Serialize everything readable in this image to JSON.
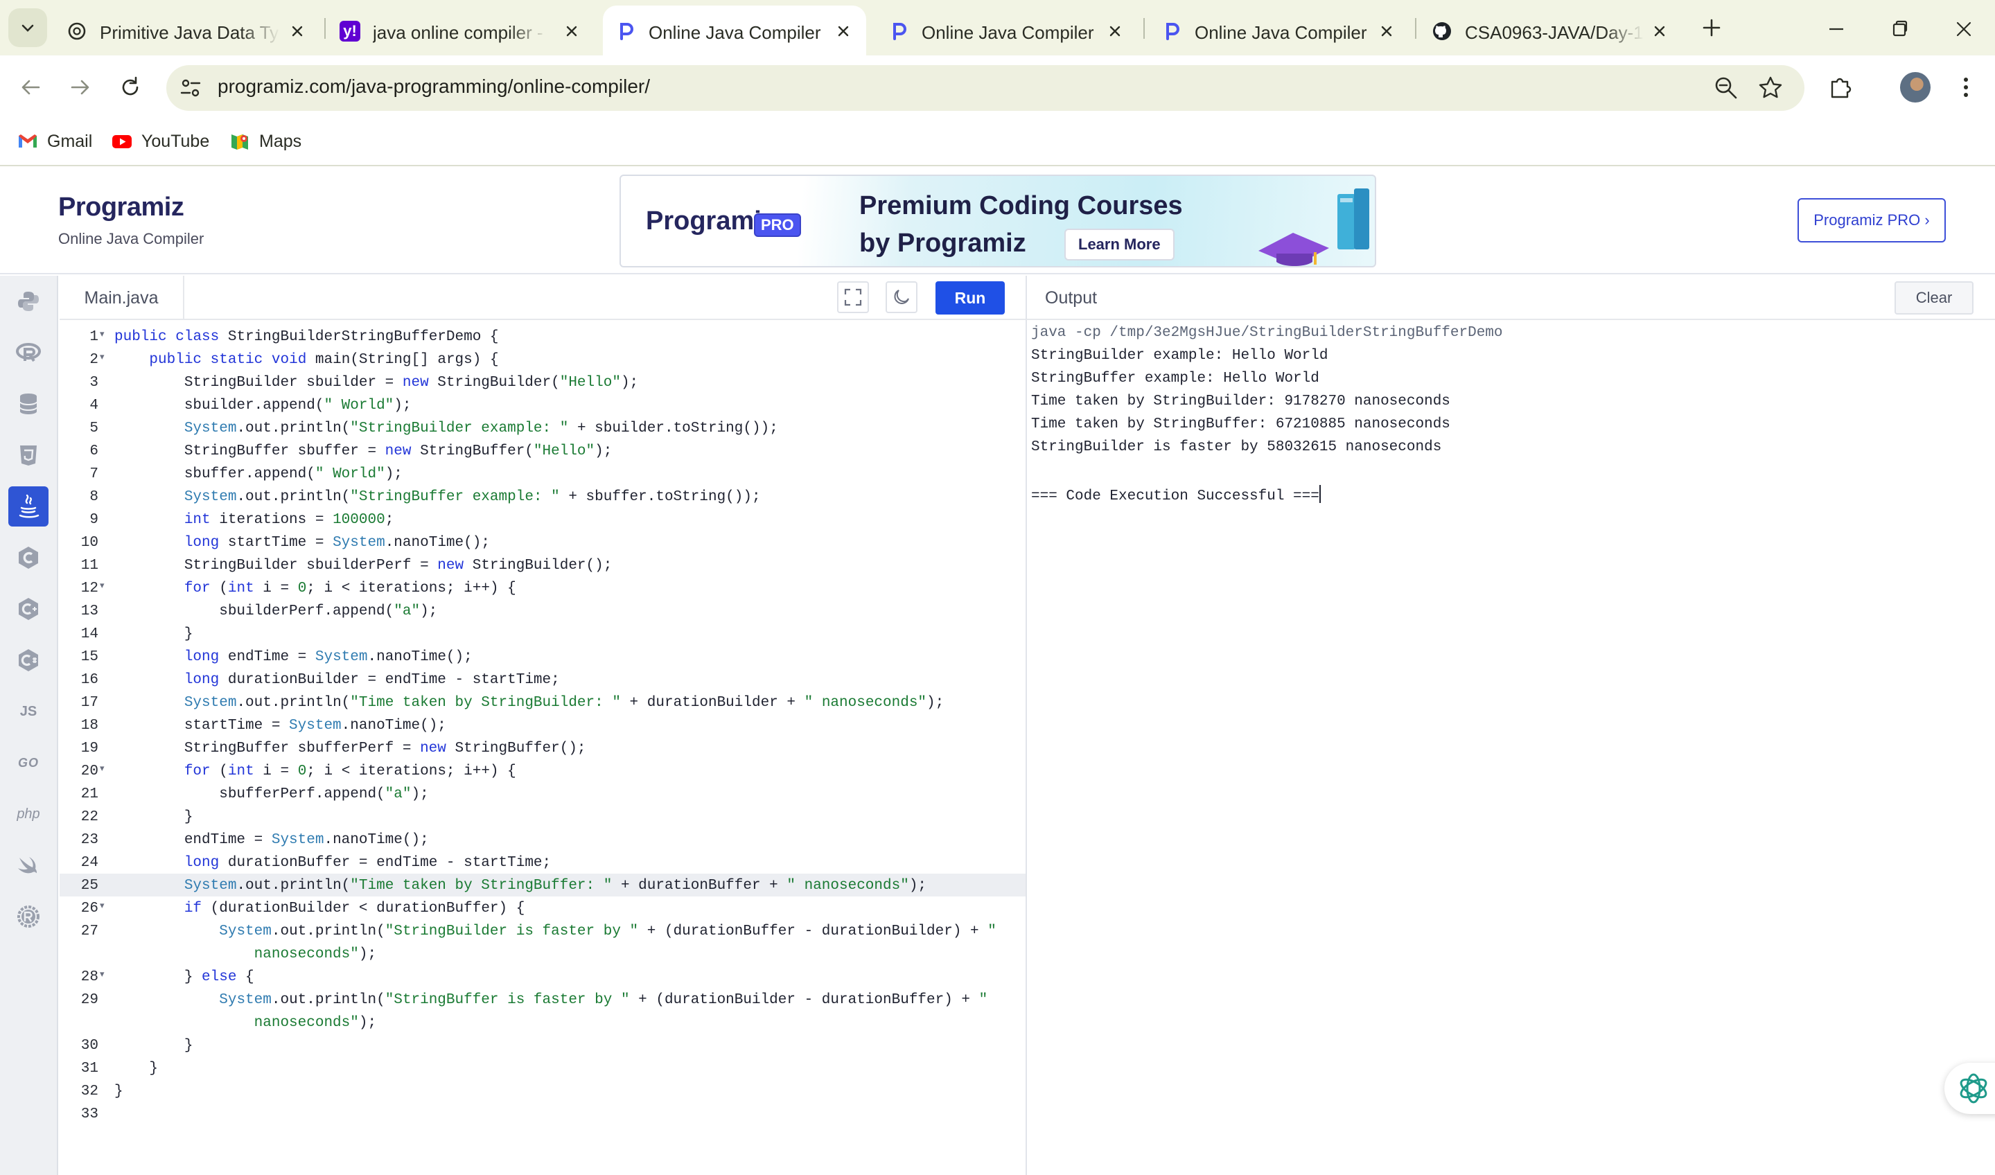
{
  "browser": {
    "tabs": [
      {
        "title": "Primitive Java Data Type",
        "favicon": "chatgpt-icon",
        "active": false
      },
      {
        "title": "java online compiler - Ya",
        "favicon": "yahoo-icon",
        "active": false
      },
      {
        "title": "Online Java Compiler",
        "favicon": "programiz-icon",
        "active": true
      },
      {
        "title": "Online Java Compiler",
        "favicon": "programiz-icon",
        "active": false
      },
      {
        "title": "Online Java Compiler",
        "favicon": "programiz-icon",
        "active": false
      },
      {
        "title": "CSA0963-JAVA/Day-1 a",
        "favicon": "github-icon",
        "active": false
      }
    ],
    "url": "programiz.com/java-programming/online-compiler/",
    "bookmarks": [
      {
        "label": "Gmail",
        "icon": "gmail-icon"
      },
      {
        "label": "YouTube",
        "icon": "youtube-icon"
      },
      {
        "label": "Maps",
        "icon": "maps-icon"
      }
    ]
  },
  "header": {
    "logo": "Programiz",
    "subtitle": "Online Java Compiler",
    "banner": {
      "logo": "Programiz",
      "pro_badge": "PRO",
      "line1": "Premium Coding Courses",
      "line2": "by Programiz",
      "cta": "Learn More"
    },
    "pro_button": "Programiz PRO ›"
  },
  "sidebar": {
    "languages": [
      "python-icon",
      "r-icon",
      "sql-icon",
      "html-icon",
      "java-icon",
      "c-icon",
      "cpp-icon",
      "csharp-icon",
      "js-icon",
      "go-icon",
      "php-icon",
      "swift-icon",
      "rust-icon"
    ],
    "active": "java-icon",
    "js_label": "JS",
    "php_label": "php",
    "go_label": "GO"
  },
  "editor": {
    "file_name": "Main.java",
    "run_label": "Run",
    "current_line": 25,
    "lines": [
      {
        "n": "1",
        "fold": true,
        "code": "public class StringBuilderStringBufferDemo {"
      },
      {
        "n": "2",
        "fold": true,
        "code": "    public static void main(String[] args) {"
      },
      {
        "n": "3",
        "fold": false,
        "code": "        StringBuilder sbuilder = new StringBuilder(\"Hello\");"
      },
      {
        "n": "4",
        "fold": false,
        "code": "        sbuilder.append(\" World\");"
      },
      {
        "n": "5",
        "fold": false,
        "code": "        System.out.println(\"StringBuilder example: \" + sbuilder.toString());"
      },
      {
        "n": "6",
        "fold": false,
        "code": "        StringBuffer sbuffer = new StringBuffer(\"Hello\");"
      },
      {
        "n": "7",
        "fold": false,
        "code": "        sbuffer.append(\" World\");"
      },
      {
        "n": "8",
        "fold": false,
        "code": "        System.out.println(\"StringBuffer example: \" + sbuffer.toString());"
      },
      {
        "n": "9",
        "fold": false,
        "code": "        int iterations = 100000;"
      },
      {
        "n": "10",
        "fold": false,
        "code": "        long startTime = System.nanoTime();"
      },
      {
        "n": "11",
        "fold": false,
        "code": "        StringBuilder sbuilderPerf = new StringBuilder();"
      },
      {
        "n": "12",
        "fold": true,
        "code": "        for (int i = 0; i < iterations; i++) {"
      },
      {
        "n": "13",
        "fold": false,
        "code": "            sbuilderPerf.append(\"a\");"
      },
      {
        "n": "14",
        "fold": false,
        "code": "        }"
      },
      {
        "n": "15",
        "fold": false,
        "code": "        long endTime = System.nanoTime();"
      },
      {
        "n": "16",
        "fold": false,
        "code": "        long durationBuilder = endTime - startTime;"
      },
      {
        "n": "17",
        "fold": false,
        "code": "        System.out.println(\"Time taken by StringBuilder: \" + durationBuilder + \" nanoseconds\");"
      },
      {
        "n": "18",
        "fold": false,
        "code": "        startTime = System.nanoTime();"
      },
      {
        "n": "19",
        "fold": false,
        "code": "        StringBuffer sbufferPerf = new StringBuffer();"
      },
      {
        "n": "20",
        "fold": true,
        "code": "        for (int i = 0; i < iterations; i++) {"
      },
      {
        "n": "21",
        "fold": false,
        "code": "            sbufferPerf.append(\"a\");"
      },
      {
        "n": "22",
        "fold": false,
        "code": "        }"
      },
      {
        "n": "23",
        "fold": false,
        "code": "        endTime = System.nanoTime();"
      },
      {
        "n": "24",
        "fold": false,
        "code": "        long durationBuffer = endTime - startTime;"
      },
      {
        "n": "25",
        "fold": false,
        "code": "        System.out.println(\"Time taken by StringBuffer: \" + durationBuffer + \" nanoseconds\");"
      },
      {
        "n": "26",
        "fold": true,
        "code": "        if (durationBuilder < durationBuffer) {"
      },
      {
        "n": "27",
        "fold": false,
        "code": "            System.out.println(\"StringBuilder is faster by \" + (durationBuffer - durationBuilder) + \""
      },
      {
        "n": "",
        "fold": false,
        "code": "                nanoseconds\");"
      },
      {
        "n": "28",
        "fold": true,
        "code": "        } else {"
      },
      {
        "n": "29",
        "fold": false,
        "code": "            System.out.println(\"StringBuffer is faster by \" + (durationBuilder - durationBuffer) + \""
      },
      {
        "n": "",
        "fold": false,
        "code": "                nanoseconds\");"
      },
      {
        "n": "30",
        "fold": false,
        "code": "        }"
      },
      {
        "n": "31",
        "fold": false,
        "code": "    }"
      },
      {
        "n": "32",
        "fold": false,
        "code": "}"
      },
      {
        "n": "33",
        "fold": false,
        "code": ""
      }
    ]
  },
  "output": {
    "label": "Output",
    "clear_label": "Clear",
    "lines": [
      "java -cp /tmp/3e2MgsHJue/StringBuilderStringBufferDemo",
      "StringBuilder example: Hello World",
      "StringBuffer example: Hello World",
      "Time taken by StringBuilder: 9178270 nanoseconds",
      "Time taken by StringBuffer: 67210885 nanoseconds",
      "StringBuilder is faster by 58032615 nanoseconds",
      "",
      "=== Code Execution Successful ==="
    ]
  },
  "colors": {
    "run_button": "#1f50e6",
    "active_language": "#2f55d4",
    "keyword": "#2235d8",
    "string": "#1a7a33"
  }
}
